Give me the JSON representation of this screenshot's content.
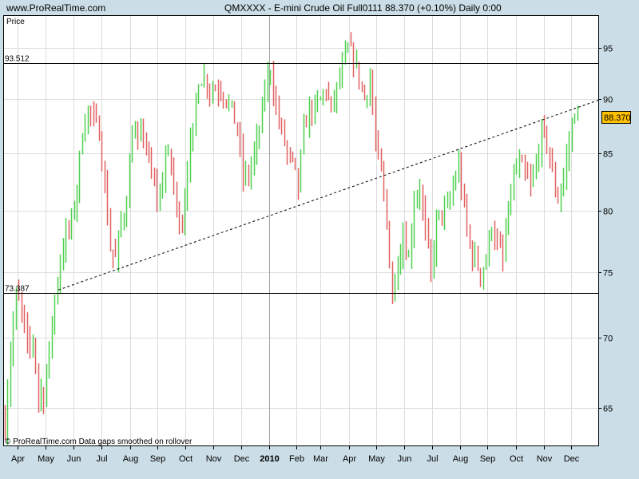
{
  "header": {
    "site": "www.ProRealTime.com",
    "title": "QMXXXX - E-mini Crude Oil Full0111    88.370 (+0.10%)    Daily  0:00"
  },
  "panel_label": "Price",
  "footer_note": "© ProRealTime.com  Data gaps smoothed on rollover",
  "last_price": "88.370",
  "colors": {
    "up": "#4fd04f",
    "down": "#e06060",
    "background": "#cbdde6",
    "last_price_box": "#ffc000"
  },
  "chart_data": {
    "type": "bar",
    "scale": "log",
    "ylim": [
      62.5,
      97.5
    ],
    "yticks": [
      "95",
      "90",
      "85",
      "80",
      "75",
      "70",
      "65"
    ],
    "ytick_values": [
      95,
      90,
      85,
      80,
      75,
      70,
      65
    ],
    "xticks": [
      "Apr",
      "May",
      "Jun",
      "Jul",
      "Aug",
      "Sep",
      "Oct",
      "Nov",
      "Dec",
      "2010",
      "Feb",
      "Mar",
      "Apr",
      "May",
      "Jun",
      "Jul",
      "Aug",
      "Sep",
      "Oct",
      "Nov",
      "Dec"
    ],
    "horizontal_lines": [
      {
        "label": "93.512",
        "value": 93.512
      },
      {
        "label": "73.387",
        "value": 73.387
      }
    ],
    "trendline": {
      "start": 73.6,
      "end": 89.9
    },
    "closes": [
      64,
      69,
      73,
      72,
      69,
      70,
      66,
      66,
      69,
      73,
      76,
      78,
      79,
      82,
      87,
      89,
      88,
      87,
      82,
      77,
      76,
      79,
      81,
      87,
      86,
      87,
      84,
      82,
      81,
      85,
      84,
      80,
      79,
      84,
      87,
      92,
      92,
      91,
      91,
      91,
      90,
      89,
      87,
      83,
      83,
      85,
      87,
      91,
      93,
      89,
      87,
      85,
      84,
      82,
      87,
      89,
      89,
      90,
      91,
      89,
      91,
      93,
      95,
      94,
      92,
      90,
      92,
      86,
      83,
      79,
      73,
      76,
      78,
      76,
      81,
      82,
      78,
      75,
      79,
      80,
      80,
      82,
      84,
      80,
      77,
      76,
      75,
      76,
      79,
      77,
      76,
      80,
      83,
      84,
      83,
      82,
      84,
      87,
      86,
      83,
      81,
      83,
      86,
      89,
      88.37
    ]
  }
}
